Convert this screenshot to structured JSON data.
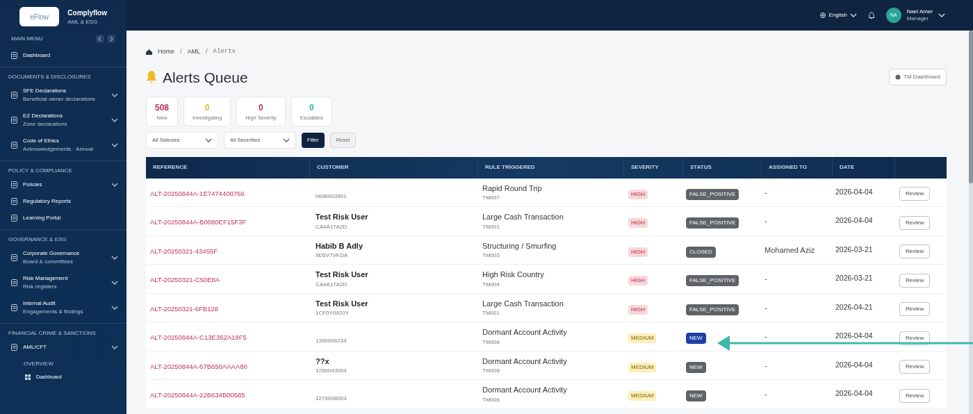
{
  "brand": {
    "logo": "eFlow",
    "name": "Complyflow",
    "tagline": "AML & ESG"
  },
  "header": {
    "language": "English",
    "user": {
      "initials": "NA",
      "name": "Nael Amer",
      "role": "Manager"
    }
  },
  "sidebar": {
    "title": "MAIN MENU",
    "sections": [
      {
        "items": [
          {
            "label": "Dashboard",
            "expandable": false
          }
        ]
      },
      {
        "heading": "DOCUMENTS & DISCLOSURES",
        "items": [
          {
            "label": "SFE Declarations",
            "sub": "Beneficial owner declarations",
            "expandable": true
          },
          {
            "label": "EZ Declarations",
            "sub": "Zone declarations",
            "expandable": true
          },
          {
            "label": "Code of Ethics",
            "sub": "Acknowledgements · Annual",
            "expandable": true
          }
        ]
      },
      {
        "heading": "POLICY & COMPLIANCE",
        "items": [
          {
            "label": "Policies",
            "expandable": true
          },
          {
            "label": "Regulatory Reports",
            "expandable": false
          },
          {
            "label": "Learning Portal",
            "expandable": false
          }
        ]
      },
      {
        "heading": "GOVERNANCE & ESG",
        "items": [
          {
            "label": "Corporate Governance",
            "sub": "Board & committees",
            "expandable": true
          },
          {
            "label": "Risk Management",
            "sub": "Risk registers",
            "expandable": true
          },
          {
            "label": "Internal Audit",
            "sub": "Engagements & findings",
            "expandable": true
          }
        ]
      },
      {
        "heading": "FINANCIAL CRIME & SANCTIONS",
        "items": [
          {
            "label": "AML/CFT",
            "expandable": true,
            "children": [
              {
                "heading": "OVERVIEW"
              },
              {
                "label": "Dashboard"
              }
            ]
          }
        ]
      }
    ]
  },
  "breadcrumb": {
    "items": [
      "Home",
      "AML",
      "Alerts"
    ],
    "separator": "/"
  },
  "page_title": "Alerts Queue",
  "tm_button": "TM Dashboard",
  "stats": [
    {
      "value": "508",
      "label": "New",
      "color": "#c0324f"
    },
    {
      "value": "0",
      "label": "Investigating",
      "color": "#e0b82a"
    },
    {
      "value": "0",
      "label": "High Severity",
      "color": "#c0324f"
    },
    {
      "value": "0",
      "label": "Escalated",
      "color": "#2bb5b0"
    }
  ],
  "filters": {
    "status": "All Statuses",
    "severity": "All Severities",
    "apply": "Filter",
    "reset": "Reset"
  },
  "table": {
    "columns": [
      "REFERENCE",
      "CUSTOMER",
      "RULE TRIGGERED",
      "SEVERITY",
      "STATUS",
      "ASSIGNED TO",
      "DATE"
    ],
    "rows": [
      {
        "reference": "ALT-20250844A-1E7474400766",
        "customer_id": "0696003901",
        "rule": "Rapid Round Trip",
        "rule_code": "TM007",
        "severity": {
          "label": "HIGH",
          "color": "#f8d7da"
        },
        "status": {
          "label": "FALSE_POSITIVE",
          "color": "#5f6368"
        },
        "assigned": "-",
        "date": "2026-04-04",
        "action": "Review"
      },
      {
        "reference": "ALT-20250844A-B0080EF15F3F",
        "customer": "Test Risk User",
        "customer_id": "CA4A1TA2D",
        "rule": "Large Cash Transaction",
        "rule_code": "TM001",
        "severity": {
          "label": "HIGH",
          "color": "#f8d7da"
        },
        "status": {
          "label": "FALSE_POSITIVE",
          "color": "#5f6368"
        },
        "assigned": "-",
        "date": "2026-04-04",
        "action": "Review"
      },
      {
        "reference": "ALT-20250321-43455F",
        "customer": "Habib B Adly",
        "customer_id": "9D5V7VKDA",
        "rule": "Structuring / Smurfing",
        "rule_code": "TM003",
        "severity": {
          "label": "HIGH",
          "color": "#f8d7da"
        },
        "status": {
          "label": "CLOSED",
          "color": "#5f6368"
        },
        "assigned": "Mohamed Aziz",
        "date": "2026-03-21",
        "action": "Review"
      },
      {
        "reference": "ALT-20250321-C50E8A",
        "customer": "Test Risk User",
        "customer_id": "CA4A1TA2D",
        "rule": "High Risk Country",
        "rule_code": "TM004",
        "severity": {
          "label": "HIGH",
          "color": "#f8d7da"
        },
        "status": {
          "label": "FALSE_POSITIVE",
          "color": "#5f6368"
        },
        "assigned": "-",
        "date": "2026-03-21",
        "action": "Review"
      },
      {
        "reference": "ALT-20250321-6FB128",
        "customer": "Test Risk User",
        "customer_id": "1CF0Y0920Y",
        "rule": "Large Cash Transaction",
        "rule_code": "TM001",
        "severity": {
          "label": "HIGH",
          "color": "#f8d7da"
        },
        "status": {
          "label": "FALSE_POSITIVE",
          "color": "#5f6368"
        },
        "assigned": "-",
        "date": "2026-04-21",
        "action": "Review"
      },
      {
        "reference": "ALT-20250844A-C13E352A19F5",
        "customer_id": "1350008234",
        "rule": "Dormant Account Activity",
        "rule_code": "TM006",
        "severity": {
          "label": "MEDIUM",
          "color": "#fbefb8"
        },
        "status": {
          "label": "NEW",
          "color": "#1d3fa8"
        },
        "assigned": "-",
        "date": "2026-04-04",
        "action": "Review"
      },
      {
        "reference": "ALT-20250844A-67B650AAAA80",
        "customer": "??x",
        "customer_id": "1250043004",
        "rule": "Dormant Account Activity",
        "rule_code": "TM006",
        "severity": {
          "label": "MEDIUM",
          "color": "#fbefb8"
        },
        "status": {
          "label": "NEW",
          "color": "#5f6368"
        },
        "assigned": "-",
        "date": "2026-04-04",
        "action": "Review"
      },
      {
        "reference": "ALT-20250844A-22B634B00585",
        "customer_id": "1279008003",
        "rule": "Dormant Account Activity",
        "rule_code": "TM006",
        "severity": {
          "label": "MEDIUM",
          "color": "#fbefb8"
        },
        "status": {
          "label": "NEW",
          "color": "#5f6368"
        },
        "assigned": "-",
        "date": "2026-04-04",
        "action": "Review"
      }
    ]
  }
}
